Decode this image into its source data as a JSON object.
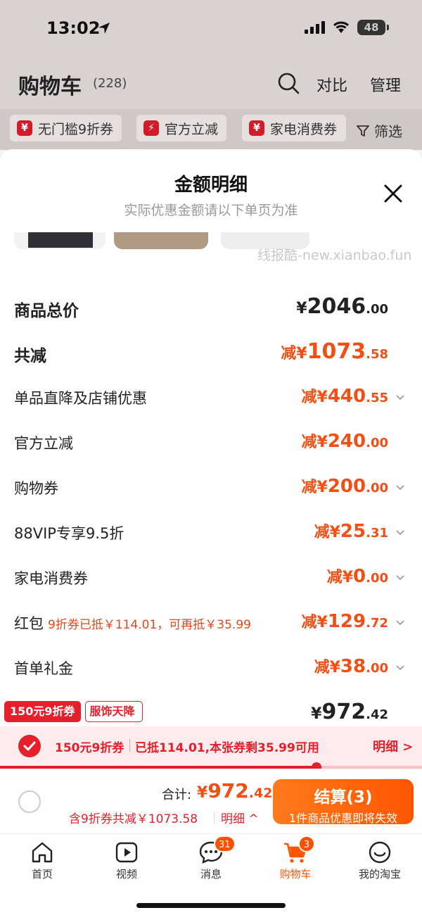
{
  "status_bar": {
    "time": "13:02",
    "battery": "48"
  },
  "header": {
    "title": "购物车",
    "count": "(228)",
    "compare": "对比",
    "manage": "管理"
  },
  "filters": {
    "chips": [
      {
        "icon": "¥",
        "label": "无门槛9折券"
      },
      {
        "icon": "⚡",
        "label": "官方立减"
      },
      {
        "icon": "¥",
        "label": "家电消费券"
      }
    ],
    "filter_label": "筛选"
  },
  "sheet": {
    "title": "金额明细",
    "subtitle": "实际优惠金额请以下单页为准",
    "watermark": "线报酷-new.xianbao.fun"
  },
  "rows": [
    {
      "label": "商品总价",
      "prefix": "¥",
      "int": "2046",
      "dec": ".00"
    },
    {
      "label": "共减",
      "prefix": "减¥",
      "int": "1073",
      "dec": ".58"
    },
    {
      "label": "单品直降及店铺优惠",
      "prefix": "减¥",
      "int": "440",
      "dec": ".55"
    },
    {
      "label": "官方立减",
      "prefix": "减¥",
      "int": "240",
      "dec": ".00"
    },
    {
      "label": "购物券",
      "prefix": "减¥",
      "int": "200",
      "dec": ".00"
    },
    {
      "label": "88VIP专享9.5折",
      "prefix": "减¥",
      "int": "25",
      "dec": ".31"
    },
    {
      "label": "家电消费券",
      "prefix": "减¥",
      "int": "0",
      "dec": ".00"
    },
    {
      "label": "红包",
      "note": "9折券已抵￥114.01，可再抵￥35.99",
      "prefix": "减¥",
      "int": "129",
      "dec": ".72"
    },
    {
      "label": "首单礼金",
      "prefix": "减¥",
      "int": "38",
      "dec": ".00"
    },
    {
      "prefix": "¥",
      "int": "972",
      "dec": ".42"
    }
  ],
  "coupon_tags": {
    "red": "150元9折券",
    "outline": "服饰天降"
  },
  "coupon_bar": {
    "name": "150元9折券",
    "status": "已抵114.01,本张券剩35.99可用",
    "detail": "明细 >",
    "progress": 0.75
  },
  "checkout": {
    "total_label": "合计:",
    "total_prefix": "¥",
    "total_int": "972",
    "total_dec": ".42",
    "saving_note": "含9折券共减￥1073.58",
    "saving_detail": "明细 ^",
    "button_main": "结算(3)",
    "button_sub": "1件商品优惠即将失效"
  },
  "tabbar": [
    {
      "label": "首页",
      "icon": "home-icon"
    },
    {
      "label": "视频",
      "icon": "video-icon"
    },
    {
      "label": "消息",
      "icon": "message-icon",
      "badge": "31"
    },
    {
      "label": "购物车",
      "icon": "cart-icon",
      "badge": "3",
      "active": true
    },
    {
      "label": "我的淘宝",
      "icon": "profile-icon"
    }
  ],
  "colors": {
    "accent": "#ff5500",
    "red": "#e51f2b",
    "price": "#f04f15"
  }
}
